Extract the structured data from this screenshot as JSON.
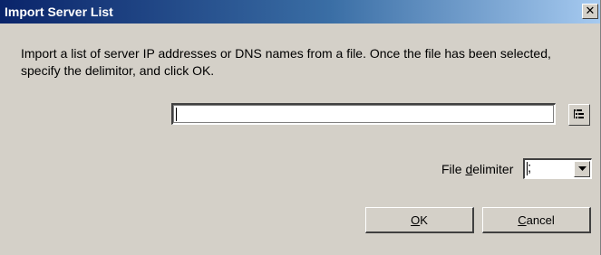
{
  "window": {
    "title": "Import Server List",
    "close_glyph": "✕",
    "close_icon": "close-icon"
  },
  "description": "Import a list of server IP addresses or DNS names from a file. Once the file has been selected, specify the delimitor, and click OK.",
  "file_input": {
    "value": "",
    "placeholder": ""
  },
  "browse": {
    "icon": "browse-file-icon"
  },
  "delimiter": {
    "label_prefix": "File ",
    "label_mnemonic": "d",
    "label_suffix": "elimiter",
    "value": ";",
    "dropdown_icon": "chevron-down-icon"
  },
  "buttons": {
    "ok_mnemonic": "O",
    "ok_rest": "K",
    "cancel_mnemonic": "C",
    "cancel_rest": "ancel"
  },
  "colors": {
    "title_gradient_start": "#0a246a",
    "title_gradient_end": "#a6caf0",
    "dialog_bg": "#d4d0c8"
  }
}
